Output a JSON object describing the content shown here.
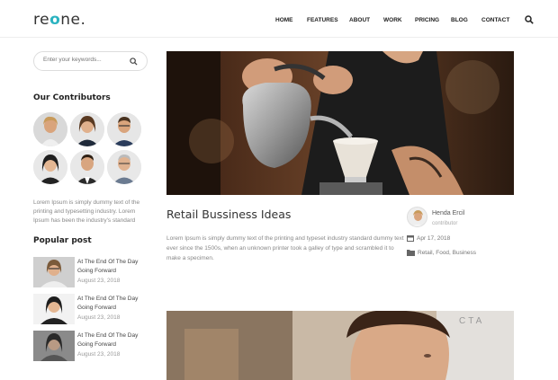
{
  "brand": {
    "logo_pre": "re",
    "logo_accent": "o",
    "logo_post": "ne.",
    "accent_color": "#2bb3c0"
  },
  "nav": {
    "items": [
      "HOME",
      "FEATURES",
      "ABOUT",
      "WORK",
      "PRICING",
      "BLOG",
      "CONTACT"
    ],
    "search_icon": "search-icon"
  },
  "sidebar": {
    "search_placeholder": "Enter your keywords...",
    "contributors_title": "Our Contributors",
    "about_text": "Lorem Ipsum is simply dummy text of the printing and typesetting industry. Lorem Ipsum has been the industry's standard",
    "popular_title": "Popular post",
    "popular_posts": [
      {
        "title": "At The End Of The Day Going Forward",
        "date": "August 23, 2018"
      },
      {
        "title": "At The End Of The Day Going Forward",
        "date": "August 23, 2018"
      },
      {
        "title": "At The End Of The Day Going Forward",
        "date": "August 23, 2018"
      }
    ]
  },
  "post": {
    "title": "Retail Bussiness Ideas",
    "excerpt": "Lorem Ipsum is simply dummy text of the printing and typeset industry standard dummy text ever since the 1500s, when an unknown printer took a galley of type and scrambled it to make a specimen.",
    "author_name": "Henda Ercil",
    "author_role": "contributor",
    "date": "Apr 17, 2018",
    "categories": "Retail, Food, Business"
  }
}
